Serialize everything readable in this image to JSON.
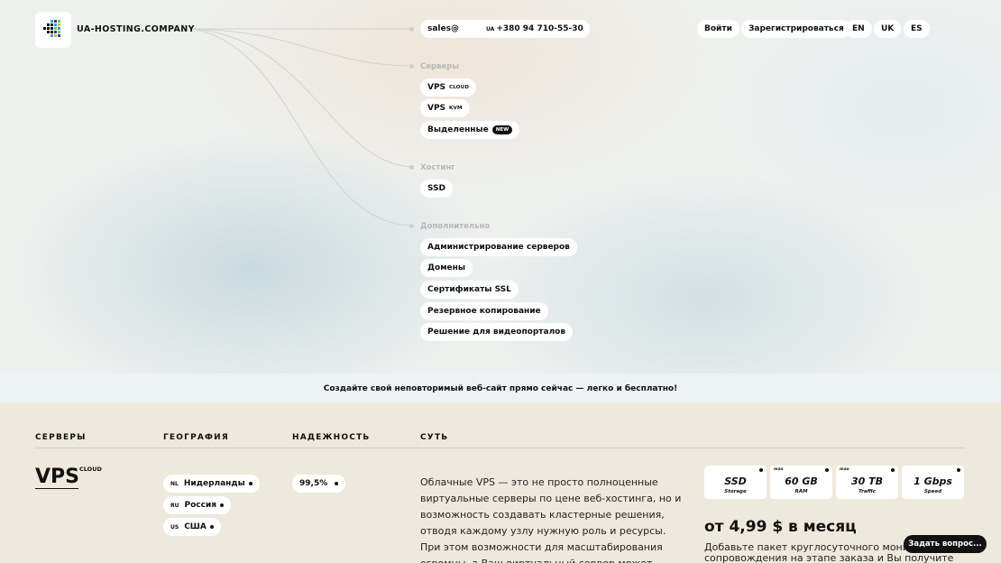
{
  "brand": {
    "name": "UA-HOSTING.COMPANY",
    "logo_icon": "grid-logo-icon"
  },
  "contact": {
    "email": "sales@",
    "phone_country": "UA",
    "phone": "+380 94 710-55-30"
  },
  "auth": {
    "login": "Войти",
    "register": "Зарегистрироваться"
  },
  "languages": [
    "EN",
    "UK",
    "ES"
  ],
  "menu": {
    "servers_label": "Серверы",
    "vps_cloud": {
      "label": "VPS",
      "tag": "CLOUD"
    },
    "vps_kvm": {
      "label": "VPS",
      "tag": "KVM"
    },
    "dedicated": {
      "label": "Выделенные",
      "badge": "NEW"
    },
    "hosting_label": "Хостинг",
    "ssd": "SSD",
    "extra_label": "Дополнительно",
    "extras": [
      "Администрирование серверов",
      "Домены",
      "Сертификаты SSL",
      "Резервное копирование",
      "Решение для видеопорталов"
    ]
  },
  "banner": "Создайте свой неповторимый веб-сайт прямо сейчас — легко и бесплатно!",
  "columns": [
    "СЕРВЕРЫ",
    "ГЕОГРАФИЯ",
    "НАДЕЖНОСТЬ",
    "СУТЬ"
  ],
  "product": {
    "title": "VPS",
    "title_sup": "CLOUD",
    "locations": [
      {
        "cc": "NL",
        "name": "Нидерланды"
      },
      {
        "cc": "RU",
        "name": "Россия"
      },
      {
        "cc": "US",
        "name": "США"
      }
    ],
    "reliability": "99,5%",
    "description": "Облачные VPS — это не просто полноценные виртуальные серверы по цене веб-хостинга, но и возможность создавать кластерные решения, отводя каждому узлу нужную роль и ресурсы. При этом возможности для масштабирования огромны, а Ваш виртуальный сервер может",
    "specs": [
      {
        "max": "",
        "value": "SSD",
        "label": "Storage"
      },
      {
        "max": "max",
        "value": "60 GB",
        "label": "RAM"
      },
      {
        "max": "max",
        "value": "30 TB",
        "label": "Traffic"
      },
      {
        "max": "",
        "value": "1 Gbps",
        "label": "Speed"
      }
    ],
    "price": "от 4,99 $ в месяц",
    "promo": "Добавьте пакет круглосуточного мониторинга и сопровождения на этапе заказа и Вы получите не"
  },
  "chat": {
    "label": "Задать вопрос..."
  }
}
